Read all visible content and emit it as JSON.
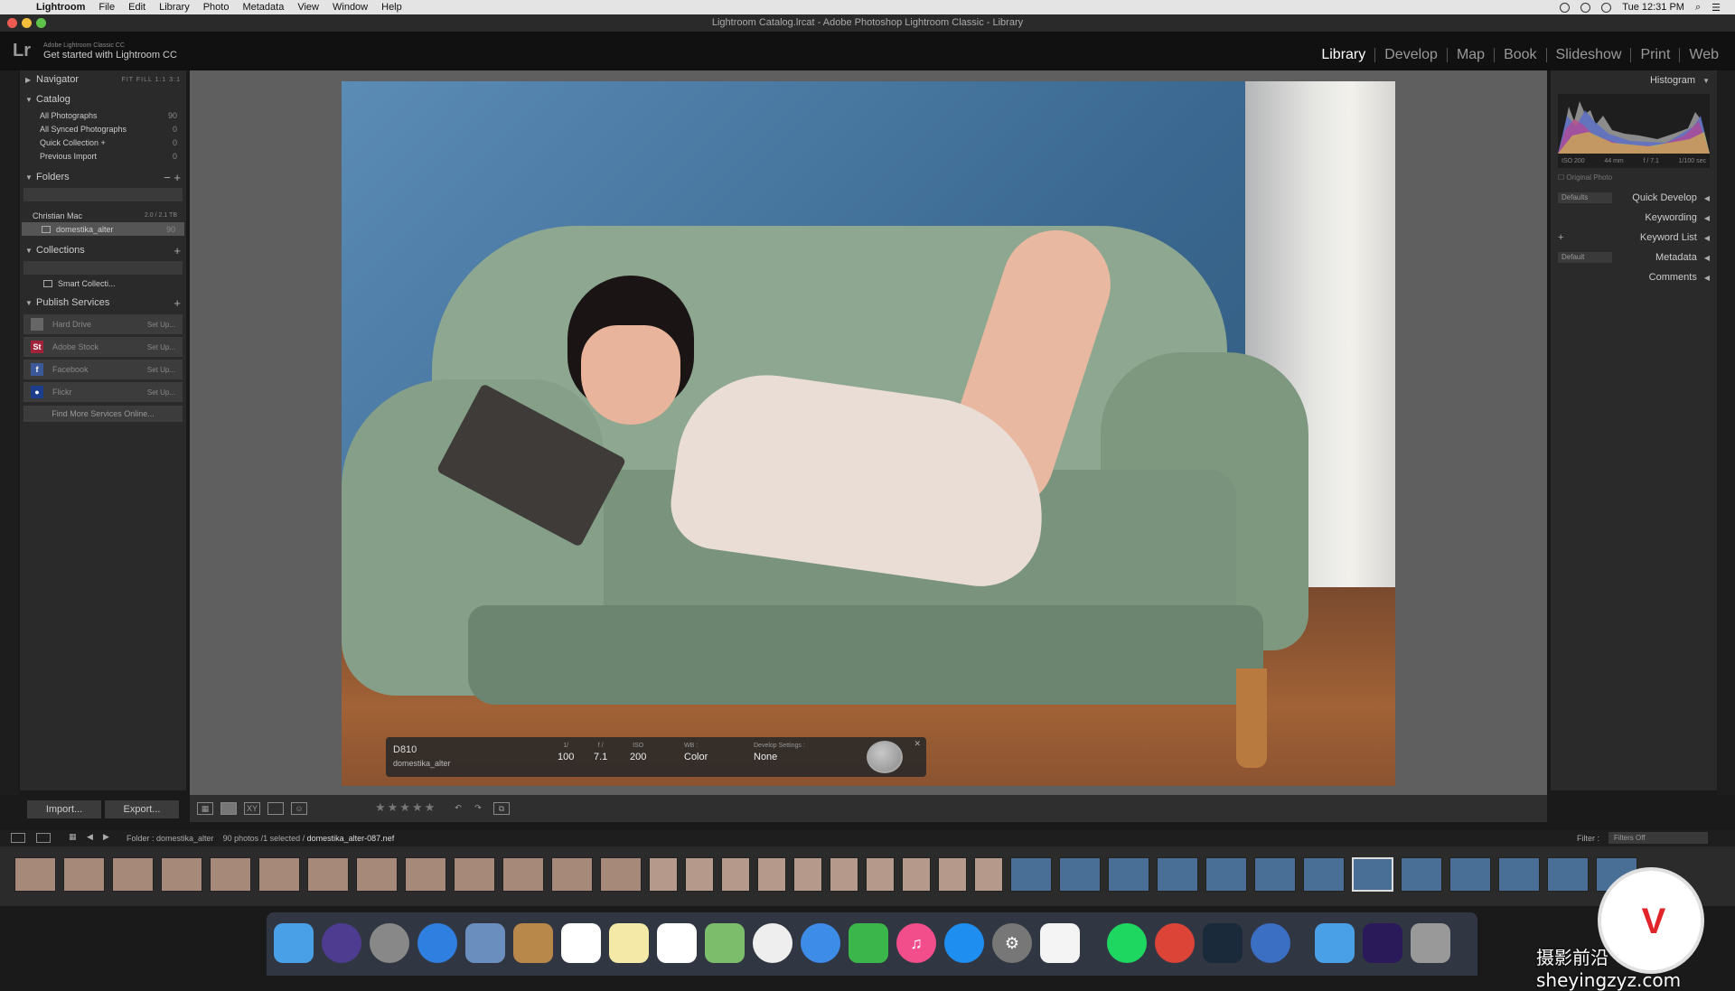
{
  "menubar": {
    "items": [
      "Lightroom",
      "File",
      "Edit",
      "Library",
      "Photo",
      "Metadata",
      "View",
      "Window",
      "Help"
    ],
    "clock": "Tue 12:31 PM"
  },
  "window": {
    "title": "Lightroom Catalog.lrcat - Adobe Photoshop Lightroom Classic - Library"
  },
  "identity": {
    "logo": "Lr",
    "line1": "Adobe Lightroom Classic CC",
    "line2": "Get started with Lightroom CC"
  },
  "modules": [
    "Library",
    "Develop",
    "Map",
    "Book",
    "Slideshow",
    "Print",
    "Web"
  ],
  "left": {
    "navigator": {
      "label": "Navigator",
      "zoom": "FIT  FILL  1:1  3:1"
    },
    "catalog": {
      "label": "Catalog",
      "items": [
        {
          "label": "All Photographs",
          "count": "90"
        },
        {
          "label": "All Synced Photographs",
          "count": "0"
        },
        {
          "label": "Quick Collection +",
          "count": "0"
        },
        {
          "label": "Previous Import",
          "count": "0"
        }
      ]
    },
    "folders": {
      "label": "Folders",
      "volume": "Christian Mac",
      "volume_size": "2.0 / 2.1 TB",
      "folder": "domestika_alter",
      "folder_count": "90"
    },
    "collections": {
      "label": "Collections",
      "smart": "Smart Collecti..."
    },
    "publish": {
      "label": "Publish Services",
      "services": [
        {
          "label": "Hard Drive",
          "setup": "Set Up..."
        },
        {
          "label": "Adobe Stock",
          "setup": "Set Up..."
        },
        {
          "label": "Facebook",
          "setup": "Set Up..."
        },
        {
          "label": "Flickr",
          "setup": "Set Up..."
        }
      ],
      "find_more": "Find More Services Online..."
    },
    "import_label": "Import...",
    "export_label": "Export..."
  },
  "hud": {
    "camera": "D810",
    "folder": "domestika_alter",
    "shutter_label": "1/",
    "shutter": "100",
    "aperture_label": "f /",
    "aperture": "7.1",
    "iso_label": "ISO",
    "iso": "200",
    "wb_label": "WB :",
    "wb": "Color",
    "dev_label": "Develop Settings :",
    "dev": "None"
  },
  "right": {
    "histogram_label": "Histogram",
    "histo_meta": [
      "ISO 200",
      "44 mm",
      "f / 7.1",
      "1/100 sec"
    ],
    "original_photo": "Original Photo",
    "quick_develop": "Quick Develop",
    "qd_preset": "Defaults",
    "keywording": "Keywording",
    "keyword_list": "Keyword List",
    "metadata": "Metadata",
    "md_preset": "Default",
    "comments": "Comments"
  },
  "filmbar": {
    "folder": "Folder : domestika_alter",
    "count": "90 photos /1 selected /",
    "file": "domestika_alter-087.nef",
    "filter_label": "Filter :",
    "filter_value": "Filters Off"
  },
  "watermark": "摄影前沿 sheyingzyz.com",
  "colors": {
    "accent": "#e0242a",
    "panel": "#2a2a2a",
    "center": "#5f5f5f"
  }
}
